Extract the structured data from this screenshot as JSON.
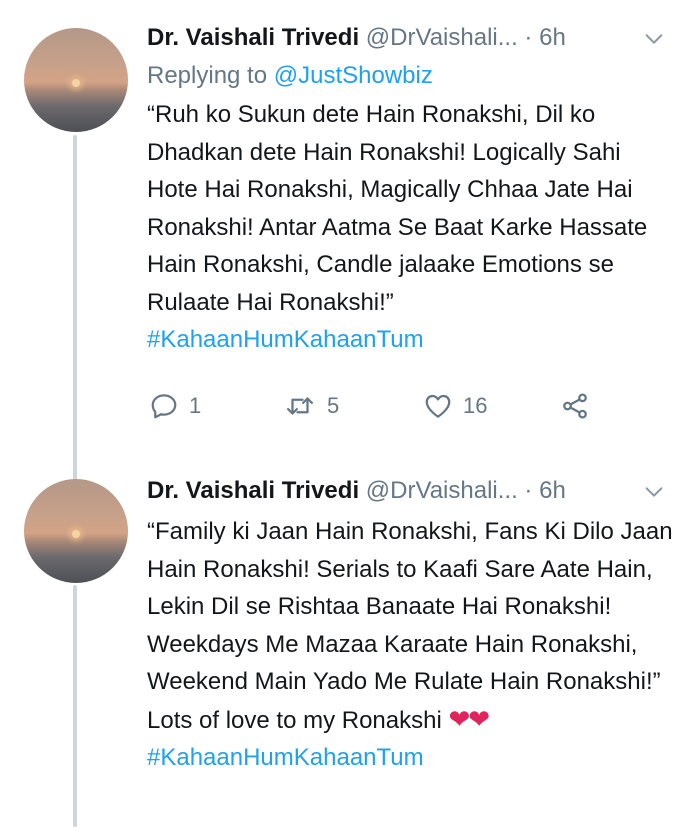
{
  "tweets": [
    {
      "author_name": "Dr. Vaishali Trivedi",
      "handle": "@DrVaishali...",
      "dot": "·",
      "time": "6h",
      "replying_prefix": "Replying to",
      "replying_to": "@JustShowbiz",
      "body": "“Ruh ko Sukun dete Hain Ronakshi, Dil ko Dhadkan dete Hain Ronakshi! Logically Sahi Hote Hai Ronakshi, Magically Chhaa Jate Hai Ronakshi! Antar Aatma Se Baat Karke Hassate Hain Ronakshi, Candle jalaake Emotions se Rulaate Hai Ronakshi!” ",
      "hashtag": "#KahaanHumKahaanTum",
      "reply_count": "1",
      "retweet_count": "5",
      "like_count": "16"
    },
    {
      "author_name": "Dr. Vaishali Trivedi",
      "handle": "@DrVaishali...",
      "dot": "·",
      "time": "6h",
      "body": "“Family ki Jaan Hain Ronakshi, Fans Ki Dilo Jaan Hain Ronakshi! Serials to Kaafi Sare Aate Hain, Lekin Dil se Rishtaa Banaate Hai Ronakshi! Weekdays Me Mazaa Karaate Hain Ronakshi, Weekend Main Yado Me Rulate Hain Ronakshi!” Lots of love to my Ronakshi ",
      "emoji": "❤❤",
      "hashtag": "#KahaanHumKahaanTum"
    }
  ],
  "icons": {
    "avatar": "sunset-avatar",
    "menu": "chevron-down-icon",
    "reply": "reply-icon",
    "retweet": "retweet-icon",
    "like": "heart-icon",
    "share": "share-icon"
  },
  "colors": {
    "link": "#1da1f2",
    "secondary_text": "#657786",
    "thread_line": "#ccd6dd",
    "heart": "#e0245e"
  }
}
